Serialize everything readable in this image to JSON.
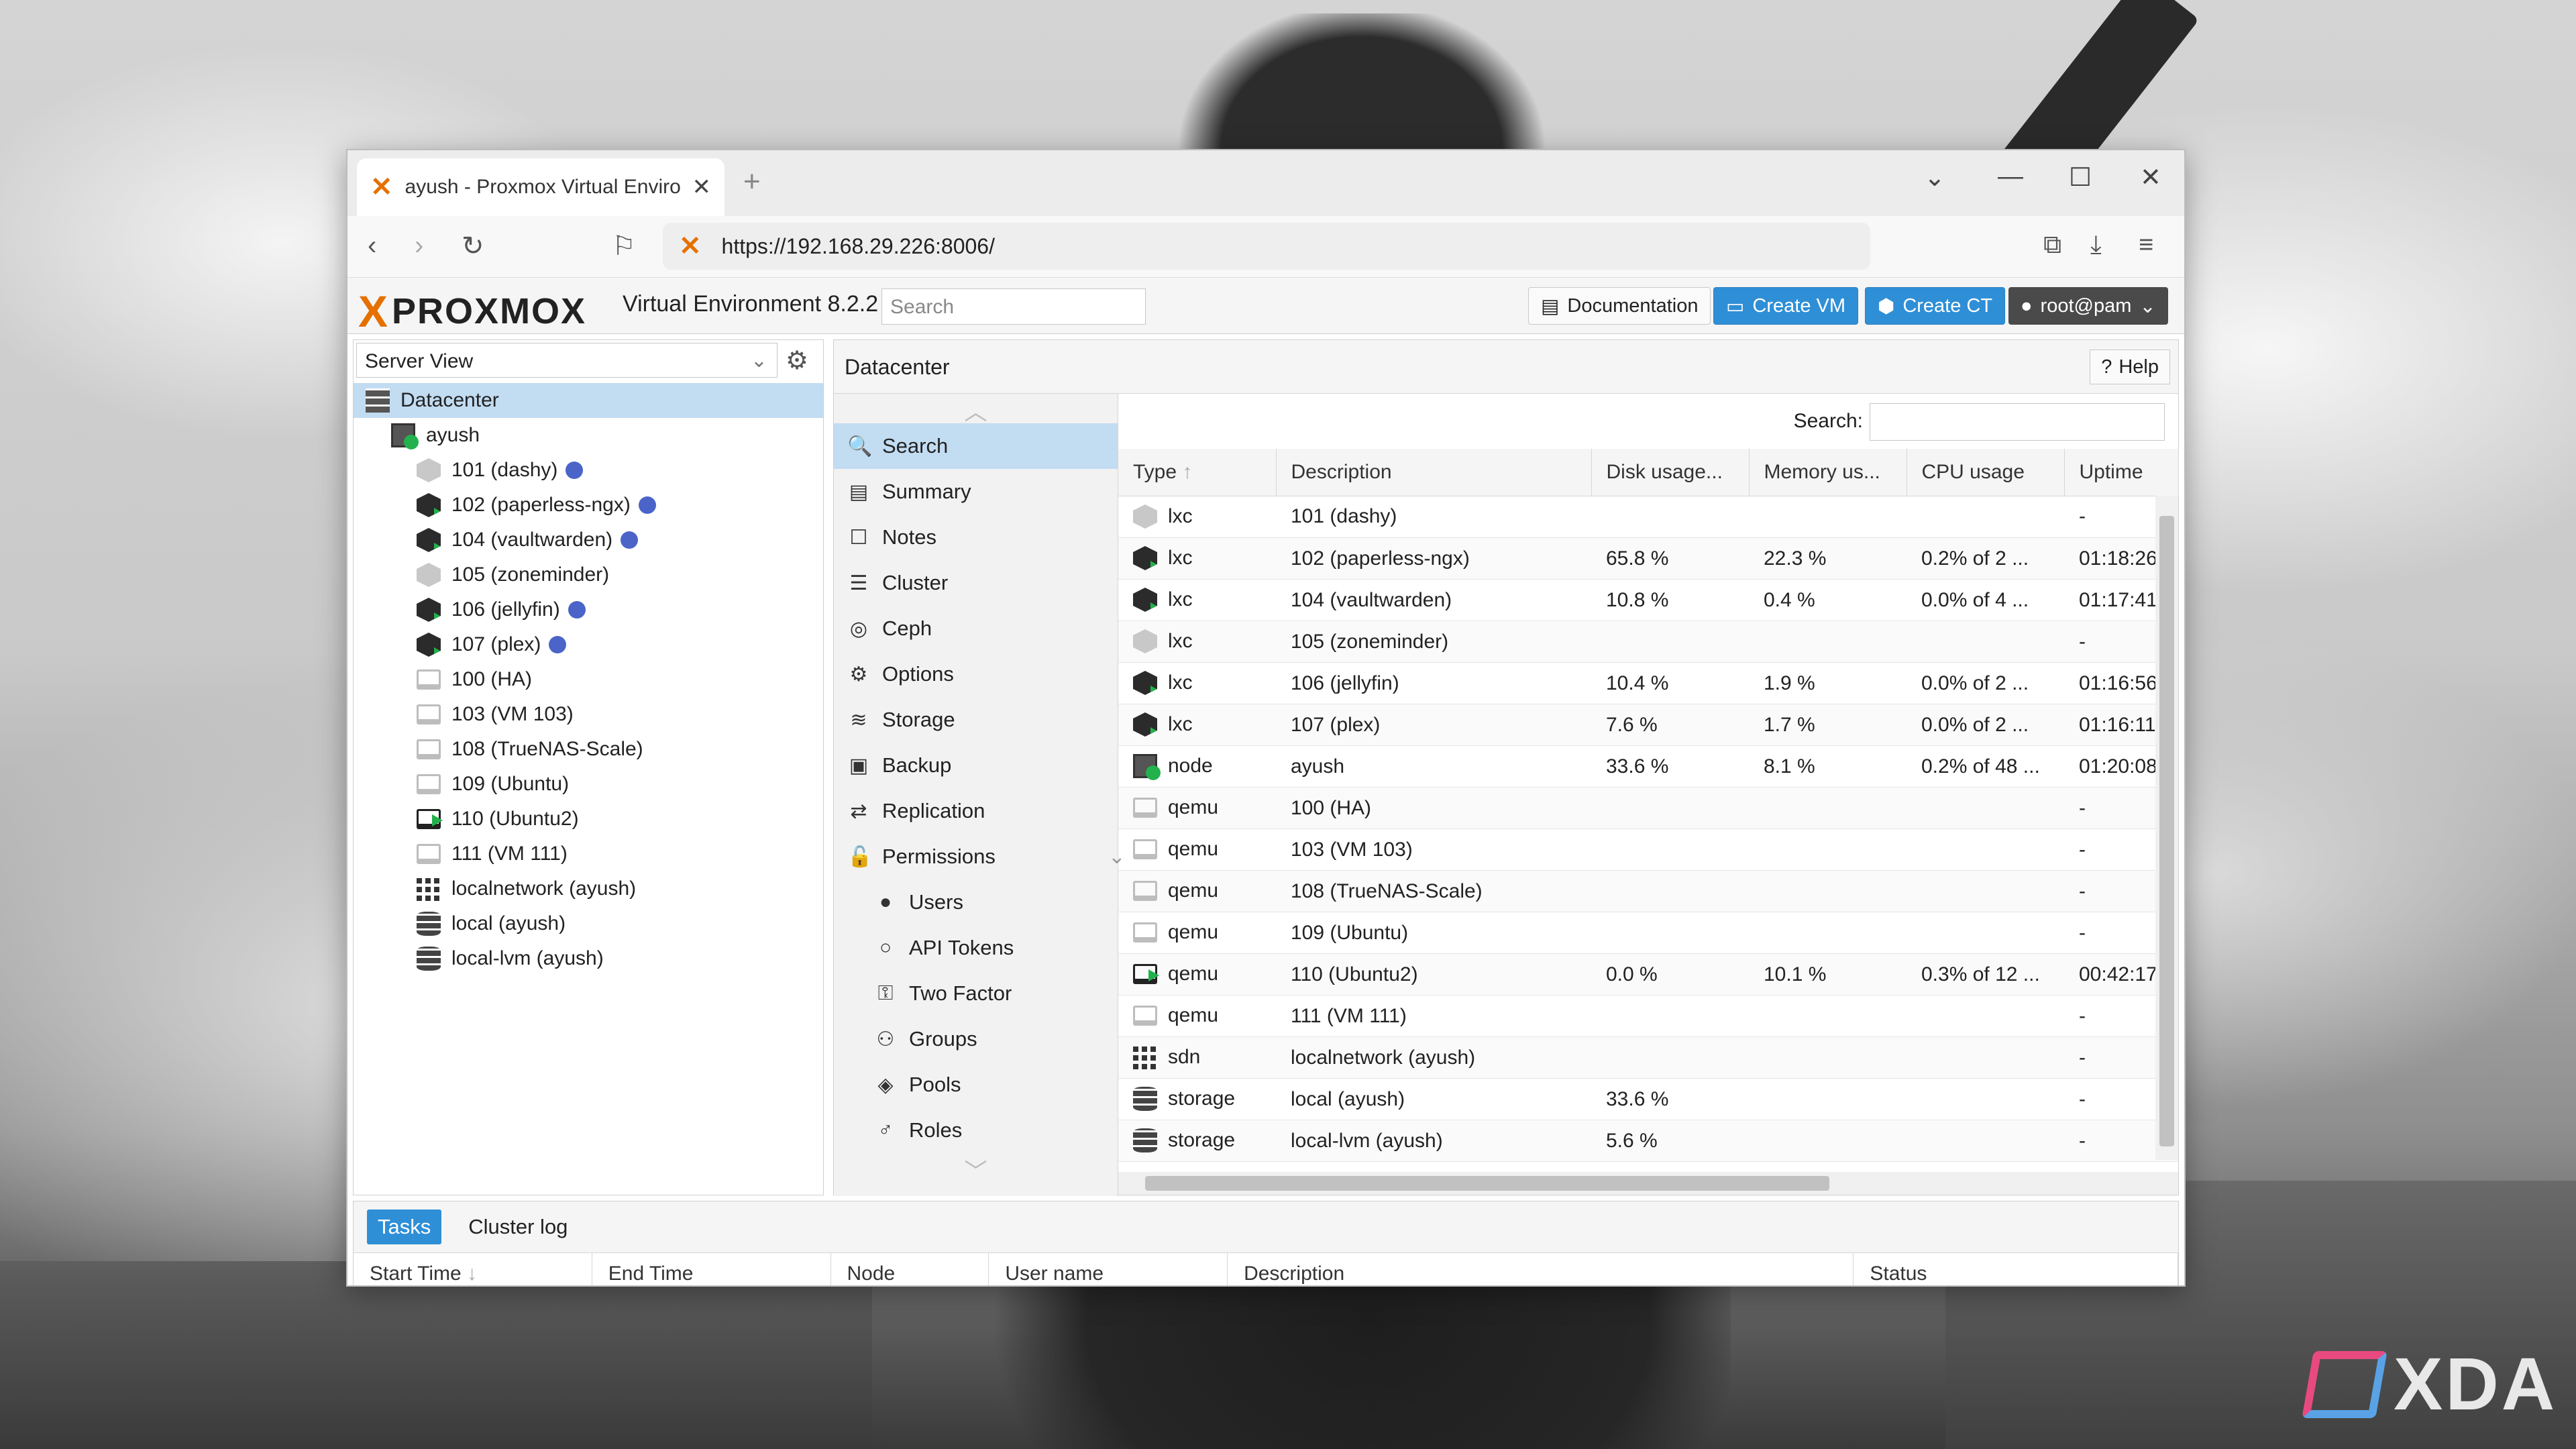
{
  "browser": {
    "tab_title": "ayush - Proxmox Virtual Environ",
    "url": "https://192.168.29.226:8006/"
  },
  "header": {
    "brand": "PROXMOX",
    "version": "Virtual Environment 8.2.2",
    "search_placeholder": "Search",
    "documentation_label": "Documentation",
    "create_vm_label": "Create VM",
    "create_ct_label": "Create CT",
    "user_label": "root@pam"
  },
  "tree": {
    "view_selector": "Server View",
    "nodes": [
      {
        "label": "Datacenter",
        "icon": "datacenter-icon",
        "level": 0
      },
      {
        "label": "ayush",
        "icon": "node-icon",
        "level": 1
      },
      {
        "label": "101 (dashy)",
        "icon": "container-icon",
        "level": 2,
        "running": false,
        "tag": true
      },
      {
        "label": "102 (paperless-ngx)",
        "icon": "container-icon",
        "level": 2,
        "running": true,
        "tag": true
      },
      {
        "label": "104 (vaultwarden)",
        "icon": "container-icon",
        "level": 2,
        "running": true,
        "tag": true
      },
      {
        "label": "105 (zoneminder)",
        "icon": "container-icon",
        "level": 2,
        "running": false,
        "tag": false
      },
      {
        "label": "106 (jellyfin)",
        "icon": "container-icon",
        "level": 2,
        "running": true,
        "tag": true
      },
      {
        "label": "107 (plex)",
        "icon": "container-icon",
        "level": 2,
        "running": true,
        "tag": true
      },
      {
        "label": "100 (HA)",
        "icon": "vm-icon",
        "level": 2,
        "running": false
      },
      {
        "label": "103 (VM 103)",
        "icon": "vm-icon",
        "level": 2,
        "running": false
      },
      {
        "label": "108 (TrueNAS-Scale)",
        "icon": "vm-icon",
        "level": 2,
        "running": false
      },
      {
        "label": "109 (Ubuntu)",
        "icon": "vm-icon",
        "level": 2,
        "running": false
      },
      {
        "label": "110 (Ubuntu2)",
        "icon": "vm-icon",
        "level": 2,
        "running": true
      },
      {
        "label": "111 (VM 111)",
        "icon": "vm-icon",
        "level": 2,
        "running": false
      },
      {
        "label": "localnetwork (ayush)",
        "icon": "network-icon",
        "level": 2
      },
      {
        "label": "local (ayush)",
        "icon": "storage-icon",
        "level": 2
      },
      {
        "label": "local-lvm (ayush)",
        "icon": "storage-icon",
        "level": 2
      }
    ]
  },
  "content": {
    "title": "Datacenter",
    "help_label": "Help",
    "search_label": "Search:",
    "menu": [
      {
        "label": "Search",
        "icon": "search-icon",
        "sub": false
      },
      {
        "label": "Summary",
        "icon": "book-icon",
        "sub": false
      },
      {
        "label": "Notes",
        "icon": "notes-icon",
        "sub": false
      },
      {
        "label": "Cluster",
        "icon": "server-icon",
        "sub": false
      },
      {
        "label": "Ceph",
        "icon": "ceph-icon",
        "sub": false
      },
      {
        "label": "Options",
        "icon": "gear-icon",
        "sub": false
      },
      {
        "label": "Storage",
        "icon": "database-icon",
        "sub": false
      },
      {
        "label": "Backup",
        "icon": "floppy-icon",
        "sub": false
      },
      {
        "label": "Replication",
        "icon": "retweet-icon",
        "sub": false
      },
      {
        "label": "Permissions",
        "icon": "unlock-icon",
        "sub": false
      },
      {
        "label": "Users",
        "icon": "user-icon",
        "sub": true
      },
      {
        "label": "API Tokens",
        "icon": "user-outline-icon",
        "sub": true
      },
      {
        "label": "Two Factor",
        "icon": "key-icon",
        "sub": true
      },
      {
        "label": "Groups",
        "icon": "users-icon",
        "sub": true
      },
      {
        "label": "Pools",
        "icon": "tags-icon",
        "sub": true
      },
      {
        "label": "Roles",
        "icon": "male-icon",
        "sub": true
      }
    ],
    "columns": [
      "Type",
      "Description",
      "Disk usage...",
      "Memory us...",
      "CPU usage",
      "Uptime"
    ],
    "rows": [
      {
        "type": "lxc",
        "desc": "101 (dashy)",
        "disk": "",
        "mem": "",
        "cpu": "",
        "uptime": "-",
        "icon": "container-icon",
        "running": false
      },
      {
        "type": "lxc",
        "desc": "102 (paperless-ngx)",
        "disk": "65.8 %",
        "mem": "22.3 %",
        "cpu": "0.2% of 2 ...",
        "uptime": "01:18:26",
        "icon": "container-icon",
        "running": true
      },
      {
        "type": "lxc",
        "desc": "104 (vaultwarden)",
        "disk": "10.8 %",
        "mem": "0.4 %",
        "cpu": "0.0% of 4 ...",
        "uptime": "01:17:41",
        "icon": "container-icon",
        "running": true
      },
      {
        "type": "lxc",
        "desc": "105 (zoneminder)",
        "disk": "",
        "mem": "",
        "cpu": "",
        "uptime": "-",
        "icon": "container-icon",
        "running": false
      },
      {
        "type": "lxc",
        "desc": "106 (jellyfin)",
        "disk": "10.4 %",
        "mem": "1.9 %",
        "cpu": "0.0% of 2 ...",
        "uptime": "01:16:56",
        "icon": "container-icon",
        "running": true
      },
      {
        "type": "lxc",
        "desc": "107 (plex)",
        "disk": "7.6 %",
        "mem": "1.7 %",
        "cpu": "0.0% of 2 ...",
        "uptime": "01:16:11",
        "icon": "container-icon",
        "running": true
      },
      {
        "type": "node",
        "desc": "ayush",
        "disk": "33.6 %",
        "mem": "8.1 %",
        "cpu": "0.2% of 48 ...",
        "uptime": "01:20:08",
        "icon": "node-icon",
        "running": true
      },
      {
        "type": "qemu",
        "desc": "100 (HA)",
        "disk": "",
        "mem": "",
        "cpu": "",
        "uptime": "-",
        "icon": "vm-icon",
        "running": false
      },
      {
        "type": "qemu",
        "desc": "103 (VM 103)",
        "disk": "",
        "mem": "",
        "cpu": "",
        "uptime": "-",
        "icon": "vm-icon",
        "running": false
      },
      {
        "type": "qemu",
        "desc": "108 (TrueNAS-Scale)",
        "disk": "",
        "mem": "",
        "cpu": "",
        "uptime": "-",
        "icon": "vm-icon",
        "running": false
      },
      {
        "type": "qemu",
        "desc": "109 (Ubuntu)",
        "disk": "",
        "mem": "",
        "cpu": "",
        "uptime": "-",
        "icon": "vm-icon",
        "running": false
      },
      {
        "type": "qemu",
        "desc": "110 (Ubuntu2)",
        "disk": "0.0 %",
        "mem": "10.1 %",
        "cpu": "0.3% of 12 ...",
        "uptime": "00:42:17",
        "icon": "vm-icon",
        "running": true
      },
      {
        "type": "qemu",
        "desc": "111 (VM 111)",
        "disk": "",
        "mem": "",
        "cpu": "",
        "uptime": "-",
        "icon": "vm-icon",
        "running": false
      },
      {
        "type": "sdn",
        "desc": "localnetwork (ayush)",
        "disk": "",
        "mem": "",
        "cpu": "",
        "uptime": "-",
        "icon": "network-icon",
        "running": false
      },
      {
        "type": "storage",
        "desc": "local (ayush)",
        "disk": "33.6 %",
        "mem": "",
        "cpu": "",
        "uptime": "-",
        "icon": "storage-icon",
        "running": false
      },
      {
        "type": "storage",
        "desc": "local-lvm (ayush)",
        "disk": "5.6 %",
        "mem": "",
        "cpu": "",
        "uptime": "-",
        "icon": "storage-icon",
        "running": false
      }
    ]
  },
  "bottom": {
    "tabs": [
      "Tasks",
      "Cluster log"
    ],
    "columns": [
      "Start Time",
      "End Time",
      "Node",
      "User name",
      "Description",
      "Status"
    ]
  },
  "watermark": "XDA",
  "colors": {
    "accent": "#2f8fd6",
    "brand": "#e57000",
    "selected": "#c2dcf2",
    "running": "#22b14c",
    "tag": "#4a64c8"
  }
}
